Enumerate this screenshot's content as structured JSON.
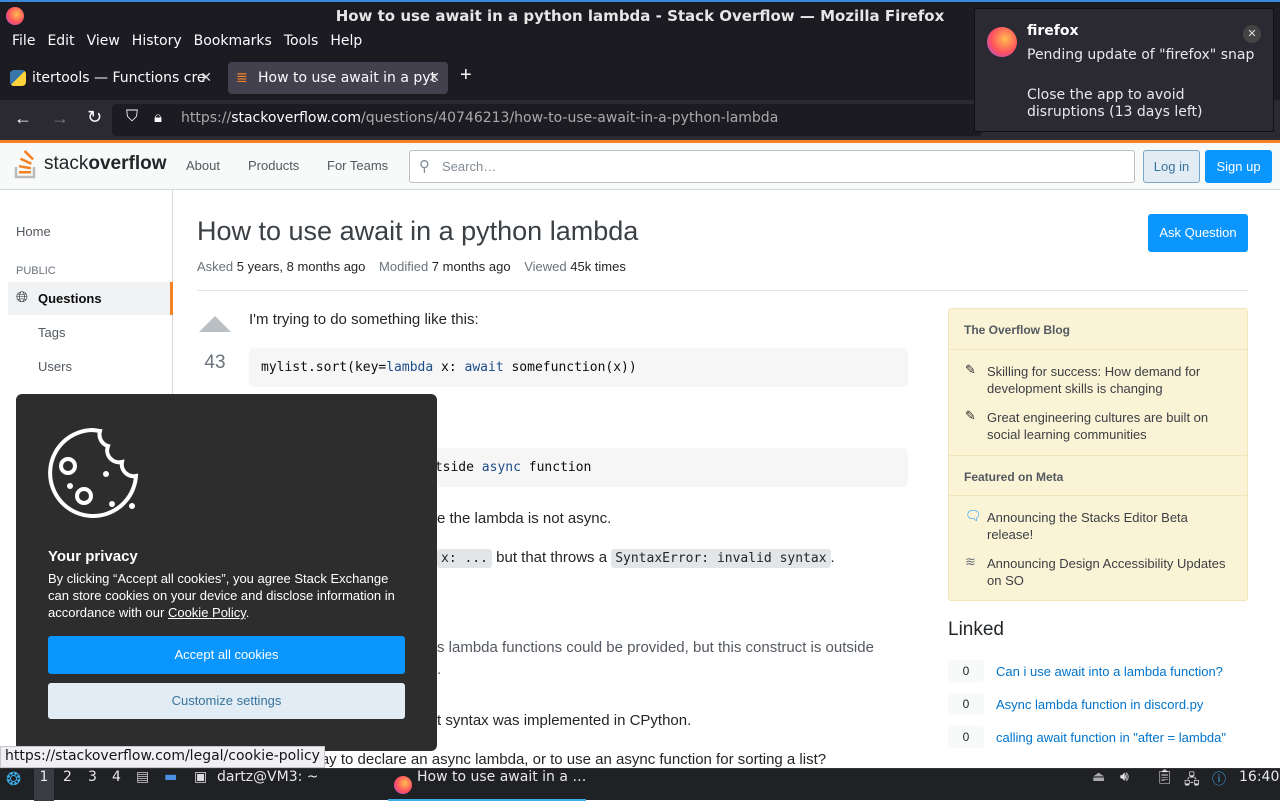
{
  "window": {
    "title": "How to use await in a python lambda - Stack Overflow — Mozilla Firefox"
  },
  "menu": [
    "File",
    "Edit",
    "View",
    "History",
    "Bookmarks",
    "Tools",
    "Help"
  ],
  "tabs": [
    {
      "label": "itertools — Functions cre"
    },
    {
      "label": "How to use await in a pyt"
    }
  ],
  "url": {
    "prefix": "https://",
    "host": "stackoverflow.com",
    "path": "/questions/40746213/how-to-use-await-in-a-python-lambda"
  },
  "so": {
    "logo_plain": "stack",
    "logo_bold": "overflow",
    "nav": [
      "About",
      "Products",
      "For Teams"
    ],
    "search_placeholder": "Search…",
    "login": "Log in",
    "signup": "Sign up"
  },
  "sidebar": {
    "home": "Home",
    "public": "PUBLIC",
    "questions": "Questions",
    "tags": "Tags",
    "users": "Users"
  },
  "question": {
    "title": "How to use await in a python lambda",
    "asked_label": "Asked",
    "asked": "5 years, 8 months ago",
    "modified_label": "Modified",
    "modified": "7 months ago",
    "viewed_label": "Viewed",
    "viewed": "45k times",
    "ask_button": "Ask Question",
    "votes": "43",
    "p1": "I'm trying to do something like this:",
    "code1_a": "mylist.sort(key=",
    "code1_kw1": "lambda",
    "code1_b": " x: ",
    "code1_kw2": "await",
    "code1_c": " somefunction(x))",
    "code2_a": "utside ",
    "code2_kw": "async",
    "code2_b": " function",
    "p2": "e the lambda is not async.",
    "p3_code": "x: ...",
    "p3_mid": " but that throws a ",
    "p3_code2": "SyntaxError: invalid syntax",
    "p3_end": ".",
    "p4": "s lambda functions could be provided, but this construct is outside",
    "p4b": ".",
    "p5": "t syntax was implemented in CPython.",
    "p6": "way to declare an async lambda, or to use an async function for sorting a list?"
  },
  "blog": {
    "header1": "The Overflow Blog",
    "item1": "Skilling for success: How demand for development skills is changing",
    "item2": "Great engineering cultures are built on social learning communities",
    "header2": "Featured on Meta",
    "item3": "Announcing the Stacks Editor Beta release!",
    "item4": "Announcing Design Accessibility Updates on SO"
  },
  "linked": {
    "title": "Linked",
    "items": [
      {
        "score": "0",
        "text": "Can i use await into a lambda function?"
      },
      {
        "score": "0",
        "text": "Async lambda function in discord.py"
      },
      {
        "score": "0",
        "text": "calling await function in \"after = lambda\""
      }
    ]
  },
  "cookie": {
    "title": "Your privacy",
    "text": "By clicking “Accept all cookies”, you agree Stack Exchange can store cookies on your device and disclose information in accordance with our ",
    "link": "Cookie Policy",
    "text_end": ".",
    "accept": "Accept all cookies",
    "customize": "Customize settings"
  },
  "statusbar": {
    "link": "https://stackoverflow.com/legal/cookie-policy"
  },
  "notification": {
    "app": "firefox",
    "line1": "Pending update of \"firefox\" snap",
    "line2": "Close the app to avoid disruptions (13 days left)"
  },
  "taskbar": {
    "workspaces": [
      "1",
      "2",
      "3",
      "4"
    ],
    "terminal": "dartz@VM3: ~",
    "window": "How to use await in a …",
    "clock": "16:40"
  },
  "colors": {
    "so_orange": "#f48225",
    "so_blue": "#0a95ff",
    "firefox_dark": "#1c1b22"
  }
}
